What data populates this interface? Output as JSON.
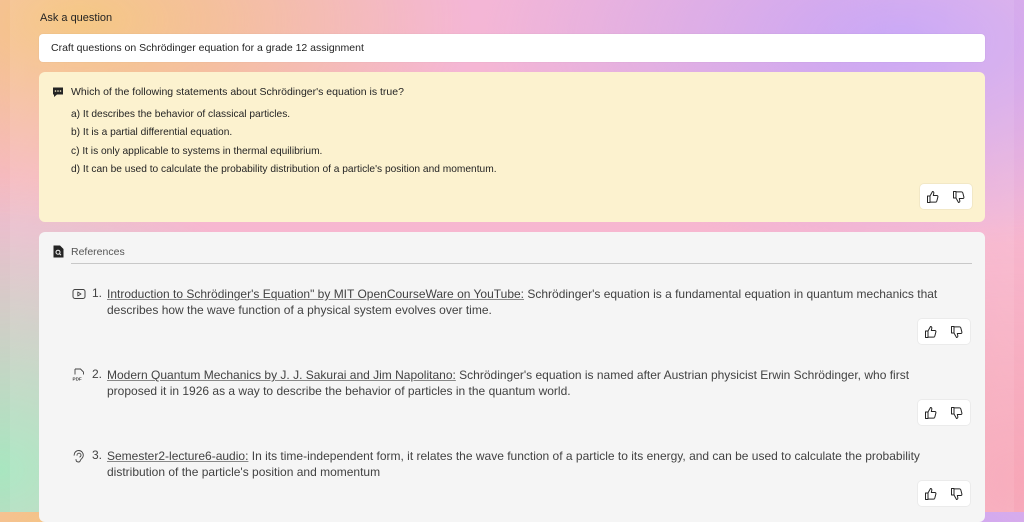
{
  "ask": {
    "label": "Ask a question",
    "value": "Craft questions on Schrödinger equation for a grade 12 assignment"
  },
  "question": {
    "icon": "chat-message-icon",
    "text": "Which of the following statements about Schrödinger's equation is true?",
    "options": [
      "a) It describes the behavior of classical particles.",
      "b) It is a partial differential equation.",
      "c) It is only applicable to systems in thermal equilibrium.",
      "d) It can be used to calculate the probability distribution of a particle's position and momentum."
    ]
  },
  "references": {
    "title": "References",
    "icon": "document-search-icon",
    "items": [
      {
        "icon": "video-play-icon",
        "number": "1.",
        "link": "Introduction to Schrödinger's Equation\" by MIT OpenCourseWare on YouTube:",
        "text": " Schrödinger's equation is a fundamental equation in quantum mechanics that describes how the wave function of a physical system evolves over time."
      },
      {
        "icon": "pdf-file-icon",
        "number": "2.",
        "link": "Modern Quantum Mechanics by J. J. Sakurai and Jim Napolitano:",
        "text": " Schrödinger's equation is named after Austrian physicist Erwin Schrödinger, who first proposed it in 1926 as a way to describe the behavior of particles in the quantum world."
      },
      {
        "icon": "audio-hearing-icon",
        "number": "3.",
        "link": "Semester2-lecture6-audio:",
        "text": " In its time-independent form, it relates the wave function of a particle to its energy, and can be used to calculate the probability distribution of the particle's position and momentum"
      }
    ]
  },
  "colors": {
    "question_bg": "#fcf2cf",
    "references_bg": "#f5f5f5",
    "text": "#242424"
  }
}
